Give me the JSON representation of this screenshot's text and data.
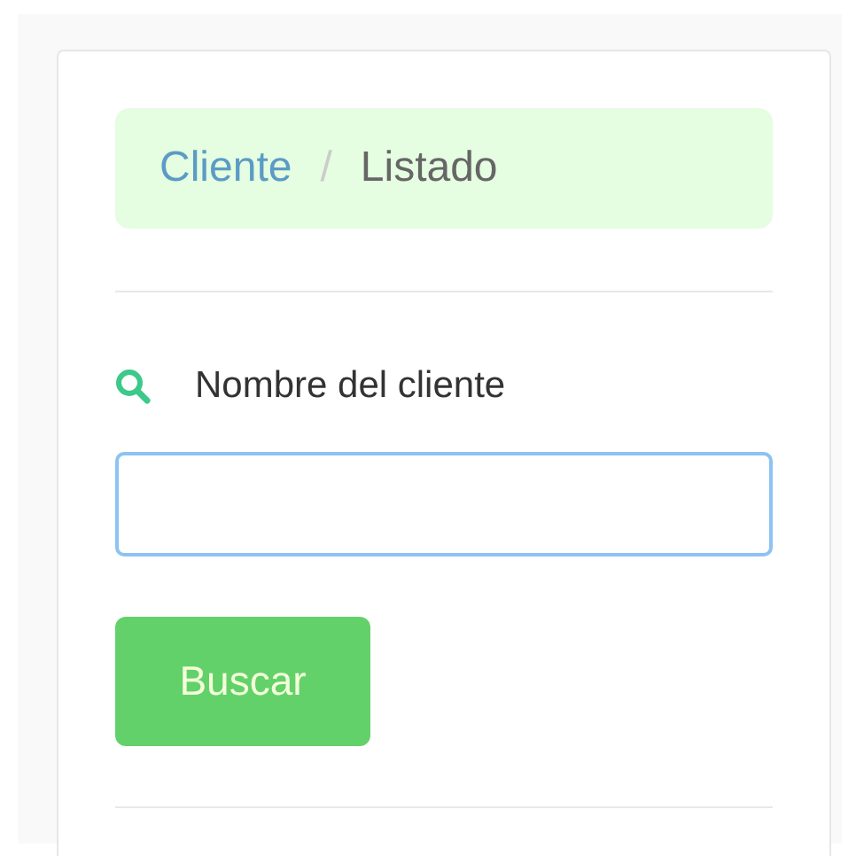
{
  "breadcrumb": [
    {
      "label": "Cliente",
      "kind": "link"
    },
    {
      "label": "/",
      "kind": "separator"
    },
    {
      "label": "Listado",
      "kind": "current"
    }
  ],
  "search": {
    "label": "Nombre del cliente",
    "focused": true
  },
  "buttons": [
    {
      "label": "Buscar"
    }
  ]
}
